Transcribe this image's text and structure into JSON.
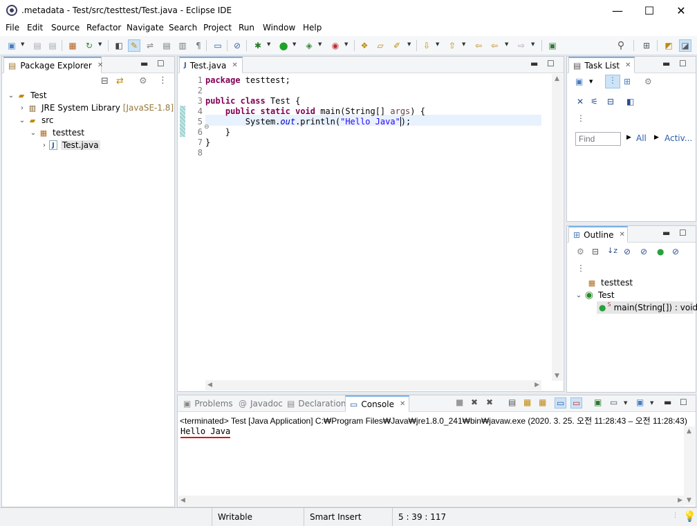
{
  "window": {
    "title": ".metadata - Test/src/testtest/Test.java - Eclipse IDE",
    "minimize": "—",
    "maximize": "☐",
    "close": "✕"
  },
  "menu": [
    "File",
    "Edit",
    "Source",
    "Refactor",
    "Navigate",
    "Search",
    "Project",
    "Run",
    "Window",
    "Help"
  ],
  "package_explorer": {
    "title": "Package Explorer",
    "tree": [
      {
        "label": "Test",
        "icon": "project-folder-icon"
      },
      {
        "label": "JRE System Library",
        "decoration": "[JavaSE-1.8]",
        "icon": "library-icon"
      },
      {
        "label": "src",
        "icon": "source-folder-icon"
      },
      {
        "label": "testtest",
        "icon": "package-icon"
      },
      {
        "label": "Test.java",
        "icon": "java-file-icon"
      }
    ]
  },
  "editor": {
    "tab": "Test.java",
    "lines": [
      "1",
      "2",
      "3",
      "4",
      "5",
      "6",
      "7",
      "8"
    ],
    "code": {
      "l1_kw": "package",
      "l1_rest": " testtest;",
      "l3_kw1": "public",
      "l3_kw2": "class",
      "l3_rest": " Test {",
      "l4_indent": "    ",
      "l4_kw1": "public",
      "l4_kw2": "static",
      "l4_kw3": "void",
      "l4_mid": " main(String[] ",
      "l4_param": "args",
      "l4_end": ") {",
      "l5_pre": "        System.",
      "l5_field": "out",
      "l5_mid": ".println(",
      "l5_str": "\"Hello Java\"",
      "l5_end": ");",
      "l6": "    }",
      "l7": "}"
    }
  },
  "task_list": {
    "title": "Task List",
    "find_placeholder": "Find",
    "all_label": "All",
    "activ_label": "Activ..."
  },
  "outline": {
    "title": "Outline",
    "items": [
      {
        "label": "testtest"
      },
      {
        "label": "Test"
      },
      {
        "label": "main(String[]) : void"
      }
    ]
  },
  "bottom_tabs": {
    "problems": "Problems",
    "javadoc": "Javadoc",
    "declaration": "Declaration",
    "console": "Console"
  },
  "console": {
    "header": "<terminated> Test [Java Application] C:₩Program Files₩Java₩jre1.8.0_241₩bin₩javaw.exe  (2020. 3. 25. 오전 11:28:43 – 오전 11:28:43)",
    "output": "Hello Java"
  },
  "status": {
    "writable": "Writable",
    "insert_mode": "Smart Insert",
    "position": "5 : 39 : 117"
  },
  "colors": {
    "keyword": "#7f0055",
    "string": "#2a00ff",
    "field": "#0000c0",
    "underline": "#e01010"
  }
}
